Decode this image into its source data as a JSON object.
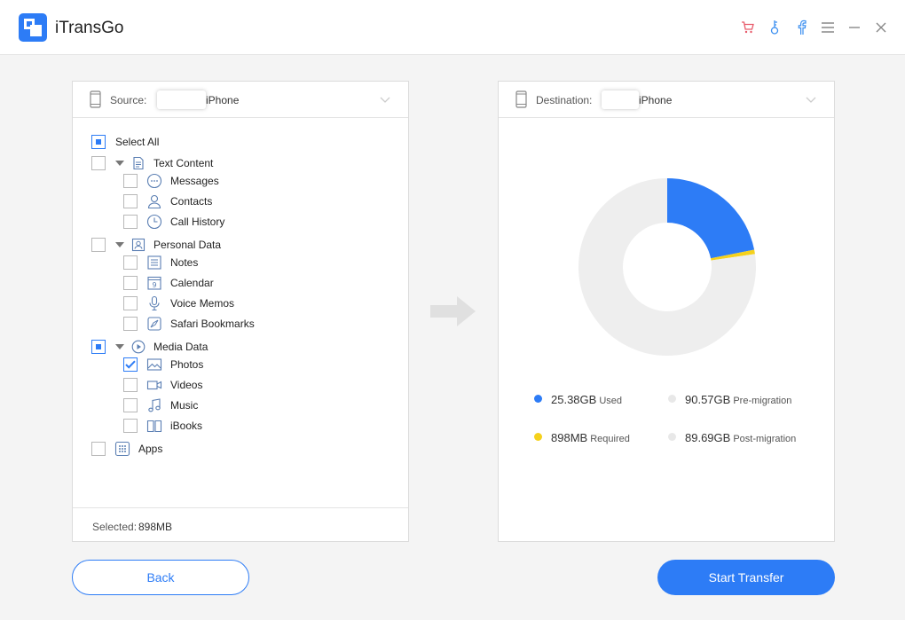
{
  "app": {
    "title": "iTransGo"
  },
  "window_controls": [
    "cart-icon",
    "key-icon",
    "facebook-icon",
    "menu-icon",
    "minimize-icon",
    "close-icon"
  ],
  "source": {
    "label": "Source:",
    "device": "iPhone",
    "tree": {
      "select_all": "Select All",
      "text_content": {
        "label": "Text Content",
        "items": [
          "Messages",
          "Contacts",
          "Call History"
        ]
      },
      "personal_data": {
        "label": "Personal Data",
        "items": [
          "Notes",
          "Calendar",
          "Voice Memos",
          "Safari Bookmarks"
        ]
      },
      "media_data": {
        "label": "Media Data",
        "items": [
          "Photos",
          "Videos",
          "Music",
          "iBooks"
        ]
      },
      "apps": "Apps"
    },
    "footer": {
      "label": "Selected:",
      "value": "898MB"
    }
  },
  "destination": {
    "label": "Destination:",
    "device": "iPhone",
    "storage": {
      "used": {
        "value": "25.38GB",
        "label": "Used",
        "color": "#2d7cf6"
      },
      "required": {
        "value": "898MB",
        "label": "Required",
        "color": "#f5d11c"
      },
      "pre_migration": {
        "value": "90.57GB",
        "label": "Pre-migration",
        "color": "#e8e8e8"
      },
      "post_migration": {
        "value": "89.69GB",
        "label": "Post-migration",
        "color": "#e8e8e8"
      }
    }
  },
  "chart_data": {
    "type": "pie",
    "donut": true,
    "slices": [
      {
        "label": "Used",
        "value": 25.38
      },
      {
        "label": "Required",
        "value": 0.898
      },
      {
        "label": "Free",
        "value": 89.69
      }
    ],
    "colors": [
      "#2d7cf6",
      "#f5d11c",
      "#eeeeee"
    ]
  },
  "buttons": {
    "back": "Back",
    "start": "Start Transfer"
  },
  "colors": {
    "accent": "#2d7cf6",
    "required": "#f5d11c"
  }
}
